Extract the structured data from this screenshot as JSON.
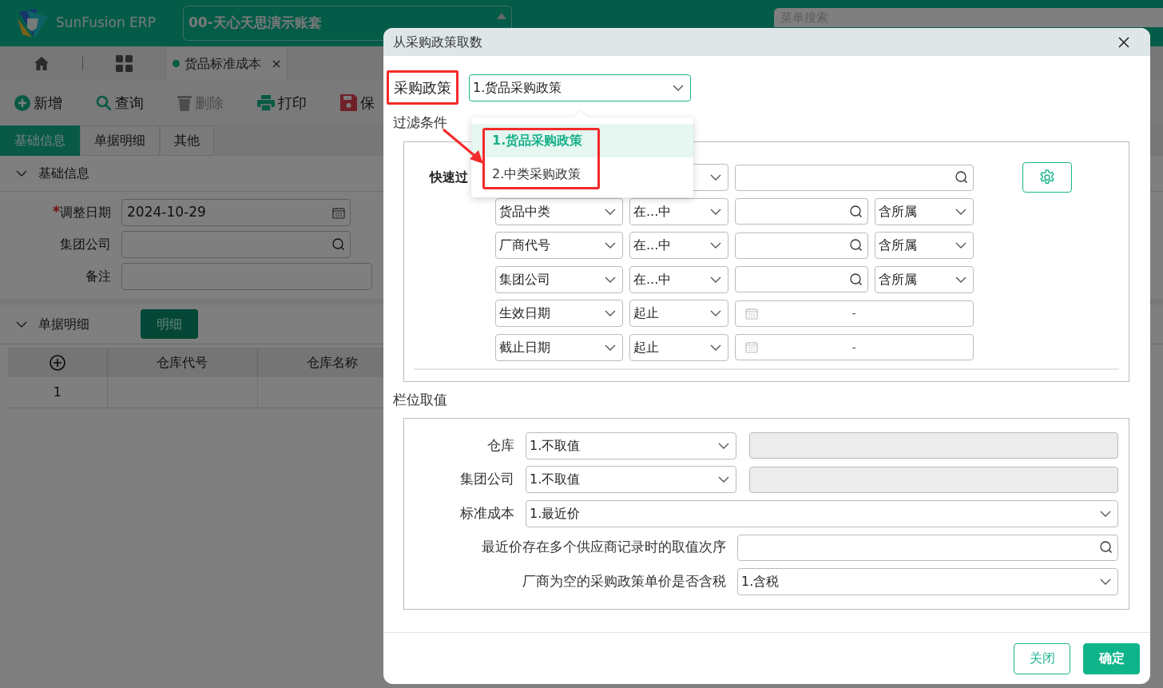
{
  "app_header": {
    "logo_text": "SunFusion ERP",
    "account": "00-天心天思演示账套",
    "menu_search": {
      "placeholder": "菜单搜索"
    }
  },
  "page_tabs": [
    {
      "label": "货品标准成本",
      "selected": true
    }
  ],
  "toolbar": [
    {
      "label": "新增",
      "kind": "add",
      "disabled": false
    },
    {
      "label": "查询",
      "kind": "search",
      "disabled": false
    },
    {
      "label": "删除",
      "kind": "delete",
      "disabled": true
    },
    {
      "label": "打印",
      "kind": "print",
      "disabled": false
    },
    {
      "label": "保",
      "kind": "save",
      "disabled": false
    }
  ],
  "form_tabs": [
    {
      "label": "基础信息",
      "selected": true
    },
    {
      "label": "单据明细",
      "selected": false
    },
    {
      "label": "其他",
      "selected": false
    }
  ],
  "basic_section": {
    "title": "基础信息",
    "expanded": true,
    "fields": [
      {
        "label": "调整日期",
        "required": true,
        "kind": "date",
        "value": "2024-10-29"
      },
      {
        "label": "集团公司",
        "required": false,
        "kind": "lookup"
      },
      {
        "label": "备注",
        "required": false,
        "kind": "text"
      }
    ]
  },
  "detail_section": {
    "title": "单据明细",
    "expanded": true,
    "button": "明细",
    "table": {
      "columns": [
        "仓库代号",
        "仓库名称"
      ],
      "rows": [
        {
          "row_number": "1"
        }
      ]
    }
  },
  "dialog": {
    "title": "从采购政策取数",
    "policy": {
      "label": "采购政策",
      "value": "1.货品采购政策",
      "options": [
        {
          "label": "1.货品采购政策",
          "selected": true
        },
        {
          "label": "2.中类采购政策",
          "selected": false
        }
      ]
    },
    "filter": {
      "title": "过滤条件",
      "quick_label": "快速过",
      "rows": [
        {
          "kind": "lookup",
          "field": "货品中类",
          "operator": "在...中",
          "scope": "含所属"
        },
        {
          "kind": "lookup",
          "field": "厂商代号",
          "operator": "在...中",
          "scope": "含所属"
        },
        {
          "kind": "lookup",
          "field": "集团公司",
          "operator": "在...中",
          "scope": "含所属"
        },
        {
          "kind": "date_range",
          "field": "生效日期",
          "operator": "起止",
          "separator": "-"
        },
        {
          "kind": "date_range",
          "field": "截止日期",
          "operator": "起止",
          "separator": "-"
        }
      ]
    },
    "field_values": {
      "title": "栏位取值",
      "rows": [
        {
          "kind": "select_pair",
          "label": "仓库",
          "value": "1.不取值"
        },
        {
          "kind": "select_pair",
          "label": "集团公司",
          "value": "1.不取值"
        },
        {
          "kind": "select",
          "label": "标准成本",
          "value": "1.最近价"
        },
        {
          "kind": "lookup",
          "label": "最近价存在多个供应商记录时的取值次序"
        },
        {
          "kind": "select",
          "label": "厂商为空的采购政策单价是否含税",
          "value": "1.含税"
        }
      ]
    },
    "buttons": [
      {
        "label": "关闭",
        "kind": "secondary"
      },
      {
        "label": "确定",
        "kind": "primary"
      }
    ]
  }
}
